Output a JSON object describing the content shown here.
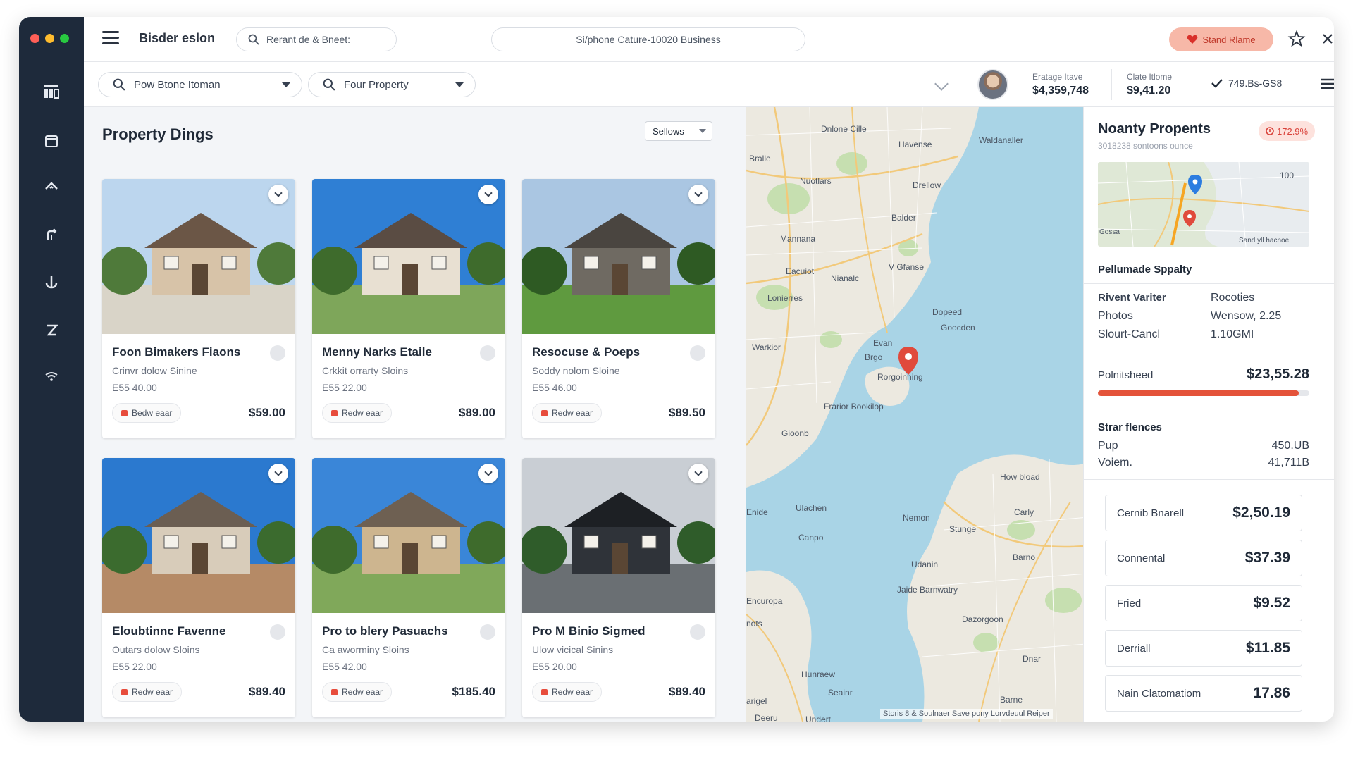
{
  "window": {
    "traffic_colors": [
      "#ff5f57",
      "#febc2e",
      "#28c840"
    ]
  },
  "topbar": {
    "app_title": "Bisder eslon",
    "search_placeholder": "Rerant de & Bneet:",
    "center_search": "Si/phone Cature-10020 Business",
    "save_label": "Stand Rlame"
  },
  "filters": {
    "first": "Pow Btone Itoman",
    "second": "Four Property"
  },
  "header_stats": [
    {
      "label": "Eratage Itave",
      "value": "$4,359,748"
    },
    {
      "label": "Clate Itlome",
      "value": "$9,41.20"
    }
  ],
  "header_check": "749.Bs-GS8",
  "listings": {
    "title": "Property Dings",
    "sort_label": "Sellows",
    "cards": [
      {
        "name": "Foon Bimakers Fiaons",
        "sub": "Crinvr dolow Sinine",
        "small_price": "E55 40.00",
        "tag": "Bedw eaar",
        "price": "$59.00"
      },
      {
        "name": "Menny Narks Etaile",
        "sub": "Crkkit orrarty Sloins",
        "small_price": "E55 22.00",
        "tag": "Redw eaar",
        "price": "$89.00"
      },
      {
        "name": "Resocuse & Poeps",
        "sub": "Soddy nolom Sloine",
        "small_price": "E55 46.00",
        "tag": "Redw eaar",
        "price": "$89.50"
      },
      {
        "name": "Eloubtinnc Favenne",
        "sub": "Outars dolow Sloins",
        "small_price": "E55 22.00",
        "tag": "Redw eaar",
        "price": "$89.40"
      },
      {
        "name": "Pro to blery Pasuachs",
        "sub": "Ca aworminy Sloins",
        "small_price": "E55 42.00",
        "tag": "Redw eaar",
        "price": "$185.40"
      },
      {
        "name": "Pro M Binio Sigmed",
        "sub": "Ulow vicical Sinins",
        "small_price": "E55 20.00",
        "tag": "Redw eaar",
        "price": "$89.40"
      }
    ]
  },
  "map": {
    "labels": [
      "Dnlone Cille",
      "Havense",
      "Waldanaller",
      "Bralle",
      "Nuotlars",
      "Drellow",
      "Balder",
      "Mannana",
      "Eacuiot",
      "Nianalc",
      "V Gfanse",
      "Lonierres",
      "Dopeed",
      "Goocden",
      "Warkior",
      "Evan",
      "Brgo",
      "Rorgoinning",
      "Frarior Bookilop",
      "Gioonb",
      "How bload",
      "Enide",
      "Ulachen",
      "Nemon",
      "Carly",
      "Stunge",
      "Canpo",
      "Barno",
      "Udanin",
      "Encuropa",
      "Jaide Barnwatry",
      "Dazorgoon",
      "nots",
      "Dnar",
      "Hunraew",
      "Seainr",
      "Barne",
      "arigel",
      "Deeru",
      "Undert"
    ],
    "attribution": "Storis 8 & Soulnaer  Save pony Lorvdeuul Reiper",
    "water_color": "#a9d4e6",
    "land_color": "#ece9e0"
  },
  "panel": {
    "title": "Noanty Propents",
    "subtitle": "3018238 sontoons ounce",
    "badge": "172.9%",
    "minimap_label_1": "100",
    "minimap_label_2": "Sand yll hacnoe",
    "minimap_label_3": "Gossa",
    "section1": "Pellumade Sppalty",
    "details": [
      {
        "k": "Rivent Variter",
        "v": "Rocoties"
      },
      {
        "k": "Photos",
        "v": "Wensow, 2.25"
      },
      {
        "k": "Slourt-Cancl",
        "v": "1.10GMI"
      }
    ],
    "progress_label": "Polnitsheed",
    "progress_value": "$23,55.28",
    "progress_fraction": 0.95,
    "section2": "Strar flences",
    "small_rows": [
      {
        "k": "Pup",
        "v": "450.UB"
      },
      {
        "k": "Voiem.",
        "v": "41,711B"
      }
    ],
    "costs": [
      {
        "k": "Cernib Bnarell",
        "v": "$2,50.19"
      },
      {
        "k": "Connental",
        "v": "$37.39"
      },
      {
        "k": "Fried",
        "v": "$9.52"
      },
      {
        "k": "Derriall",
        "v": "$11.85"
      },
      {
        "k": "Nain Clatomatiom",
        "v": "17.86"
      }
    ]
  }
}
